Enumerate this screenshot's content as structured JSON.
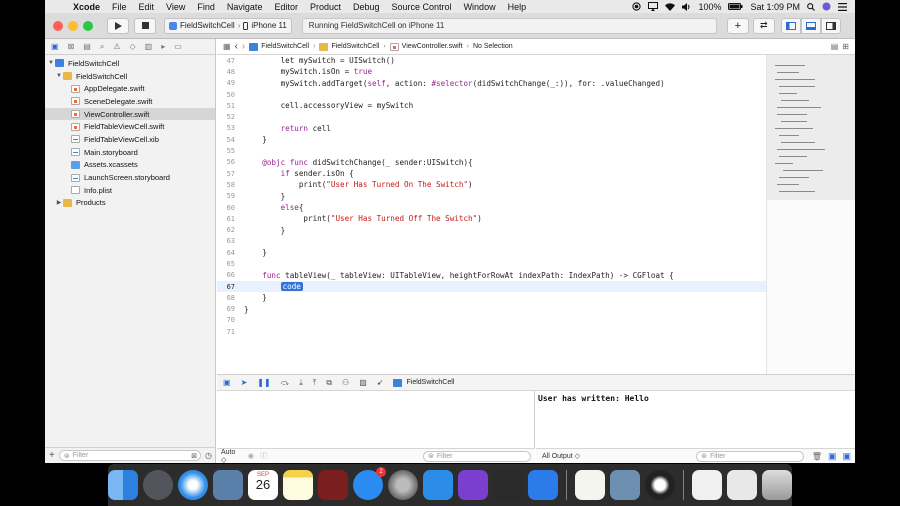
{
  "menubar": {
    "app_name": "Xcode",
    "items": [
      "File",
      "Edit",
      "View",
      "Find",
      "Navigate",
      "Editor",
      "Product",
      "Debug",
      "Source Control",
      "Window",
      "Help"
    ],
    "battery": "100%",
    "clock": "Sat 1:09 PM"
  },
  "toolbar": {
    "scheme_project": "FieldSwitchCell",
    "scheme_device": "iPhone 11",
    "status": "Running FieldSwitchCell on iPhone 11"
  },
  "navigator": {
    "items": [
      {
        "label": "FieldSwitchCell",
        "icon": "project-icon"
      },
      {
        "label": "FieldSwitchCell",
        "icon": "folder-icon"
      },
      {
        "label": "AppDelegate.swift",
        "icon": "swift-file-icon"
      },
      {
        "label": "SceneDelegate.swift",
        "icon": "swift-file-icon"
      },
      {
        "label": "ViewController.swift",
        "icon": "swift-file-icon"
      },
      {
        "label": "FieldTableViewCell.swift",
        "icon": "swift-file-icon"
      },
      {
        "label": "FieldTableViewCell.xib",
        "icon": "xib-file-icon"
      },
      {
        "label": "Main.storyboard",
        "icon": "storyboard-icon"
      },
      {
        "label": "Assets.xcassets",
        "icon": "assets-icon"
      },
      {
        "label": "LaunchScreen.storyboard",
        "icon": "storyboard-icon"
      },
      {
        "label": "Info.plist",
        "icon": "plist-icon"
      },
      {
        "label": "Products",
        "icon": "folder-icon"
      }
    ],
    "filter_placeholder": "Filter"
  },
  "jumpbar": {
    "crumbs": [
      "FieldSwitchCell",
      "FieldSwitchCell",
      "ViewController.swift",
      "No Selection"
    ]
  },
  "code": {
    "lines": [
      {
        "n": "47",
        "parts": [
          [
            "tx",
            "        let mySwitch = UISwitch()"
          ]
        ]
      },
      {
        "n": "48",
        "parts": [
          [
            "tx",
            "        mySwitch.isOn = "
          ],
          [
            "kw",
            "true"
          ]
        ]
      },
      {
        "n": "49",
        "parts": [
          [
            "tx",
            "        mySwitch.addTarget("
          ],
          [
            "kw",
            "self"
          ],
          [
            "tx",
            ", action: "
          ],
          [
            "kw",
            "#selector"
          ],
          [
            "tx",
            "(didSwitchChange(_:)), for: .valueChanged)"
          ]
        ]
      },
      {
        "n": "50",
        "parts": [
          [
            "tx",
            ""
          ]
        ]
      },
      {
        "n": "51",
        "parts": [
          [
            "tx",
            "        cell.accessoryView = mySwitch"
          ]
        ]
      },
      {
        "n": "52",
        "parts": [
          [
            "tx",
            ""
          ]
        ]
      },
      {
        "n": "53",
        "parts": [
          [
            "kw",
            "        return"
          ],
          [
            "tx",
            " cell"
          ]
        ]
      },
      {
        "n": "54",
        "parts": [
          [
            "tx",
            "    }"
          ]
        ]
      },
      {
        "n": "55",
        "parts": [
          [
            "tx",
            ""
          ]
        ]
      },
      {
        "n": "56",
        "parts": [
          [
            "kw",
            "    @objc func"
          ],
          [
            "tx",
            " didSwitchChange(_ sender:UISwitch){"
          ]
        ]
      },
      {
        "n": "57",
        "parts": [
          [
            "kw",
            "        if"
          ],
          [
            "tx",
            " sender.isOn {"
          ]
        ]
      },
      {
        "n": "58",
        "parts": [
          [
            "tx",
            "            print("
          ],
          [
            "str",
            "\"User Has Turned On The Switch\""
          ],
          [
            "tx",
            ")"
          ]
        ]
      },
      {
        "n": "59",
        "parts": [
          [
            "tx",
            "        }"
          ]
        ]
      },
      {
        "n": "60",
        "parts": [
          [
            "kw",
            "        else"
          ],
          [
            "tx",
            "{"
          ]
        ]
      },
      {
        "n": "61",
        "parts": [
          [
            "tx",
            "             print("
          ],
          [
            "str",
            "\"User Has Turned Off The Switch\""
          ],
          [
            "tx",
            ")"
          ]
        ]
      },
      {
        "n": "62",
        "parts": [
          [
            "tx",
            "        }"
          ]
        ]
      },
      {
        "n": "63",
        "parts": [
          [
            "tx",
            ""
          ]
        ]
      },
      {
        "n": "64",
        "parts": [
          [
            "tx",
            "    }"
          ]
        ]
      },
      {
        "n": "65",
        "parts": [
          [
            "tx",
            ""
          ]
        ]
      },
      {
        "n": "66",
        "parts": [
          [
            "kw",
            "    func"
          ],
          [
            "tx",
            " tableView(_ tableView: UITableView, heightForRowAt indexPath: IndexPath) -> CGFloat {"
          ]
        ]
      },
      {
        "n": "67",
        "parts": [
          [
            "tx",
            "        "
          ],
          [
            "ph",
            "code"
          ]
        ],
        "current": true
      },
      {
        "n": "68",
        "parts": [
          [
            "tx",
            "    }"
          ]
        ]
      },
      {
        "n": "69",
        "parts": [
          [
            "tx",
            "}"
          ]
        ]
      },
      {
        "n": "70",
        "parts": [
          [
            "tx",
            ""
          ]
        ]
      },
      {
        "n": "71",
        "parts": [
          [
            "tx",
            ""
          ]
        ]
      }
    ]
  },
  "debug": {
    "target": "FieldSwitchCell"
  },
  "variables": {
    "scope": "Auto ◇",
    "filter_placeholder": "Filter"
  },
  "console": {
    "output": "User has written: Hello",
    "mode": "All Output ◇",
    "filter_placeholder": "Filter"
  },
  "dock": {
    "calendar_month": "SEP",
    "calendar_day": "26",
    "appstore_badge": "2"
  }
}
